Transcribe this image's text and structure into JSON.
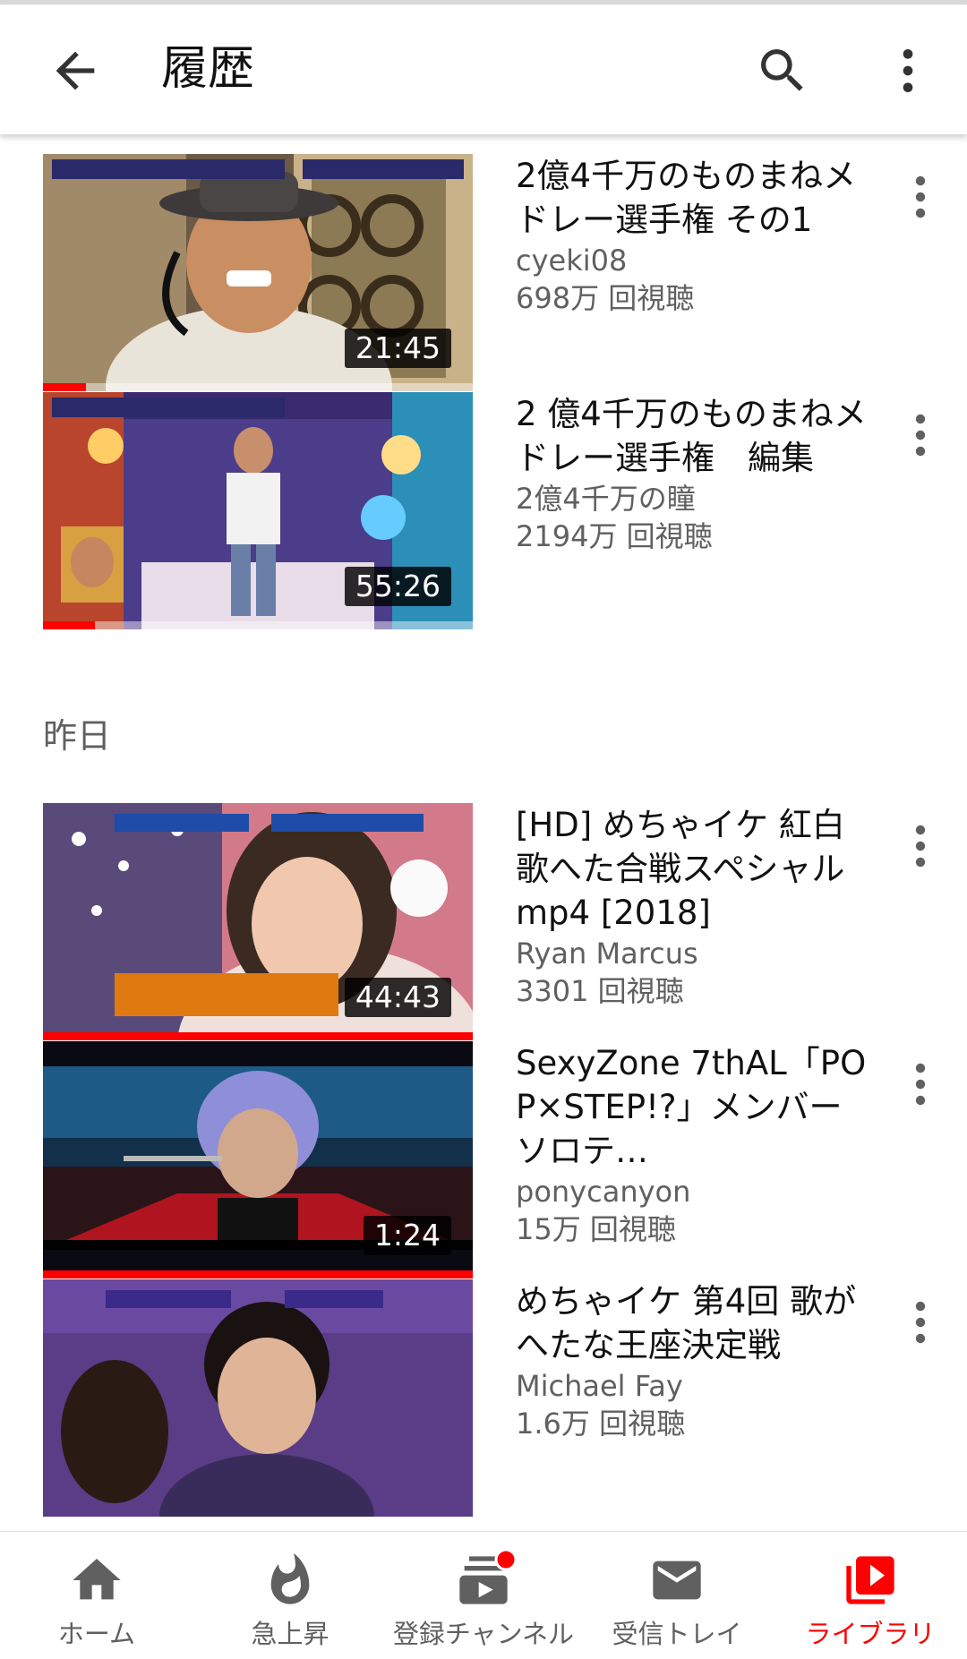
{
  "header": {
    "title": "履歴",
    "back_icon": "arrow-back-icon",
    "search_icon": "search-icon",
    "more_icon": "more-vert-icon"
  },
  "videos": [
    {
      "title": "2億4千万のものまねメドレー選手権 その1",
      "channel": "cyeki08",
      "views": "698万 回視聴",
      "duration": "21:45",
      "watched_fraction": 0.1,
      "thumb_label": "2億4千万のものまねメドレー選手権"
    },
    {
      "title": "2 億4千万のものまねメドレー選手権　編集",
      "channel": "2億4千万の瞳",
      "views": "2194万 回視聴",
      "duration": "55:26",
      "watched_fraction": 0.12,
      "thumb_label": "2億4千万のものまねメドレー選手権"
    }
  ],
  "section_yesterday": "昨日",
  "videos_yesterday": [
    {
      "title": "[HD] めちゃイケ 紅白歌へた合戦スペシャル mp4 [2018]",
      "channel": "Ryan Marcus",
      "views": "3301 回視聴",
      "duration": "44:43",
      "watched_fraction": 1.0,
      "thumb_label": "紅白歌へた合戦スペシャル",
      "thumb_caption": "生で聴く方がス"
    },
    {
      "title": "SexyZone 7thAL「POP×STEP!?」メンバーソロテ…",
      "channel": "ponycanyon",
      "views": "15万 回視聴",
      "duration": "1:24",
      "watched_fraction": 1.0
    },
    {
      "title": "めちゃイケ 第4回 歌がへたな王座決定戦",
      "channel": "Michael Fay",
      "views": "1.6万 回視聴",
      "duration": "",
      "watched_fraction": 0,
      "thumb_label": "歌がへたな王座決定戦"
    }
  ],
  "bottom_nav": [
    {
      "label": "ホーム",
      "icon": "home-icon",
      "active": false
    },
    {
      "label": "急上昇",
      "icon": "flame-icon",
      "active": false
    },
    {
      "label": "登録チャンネル",
      "icon": "subscriptions-icon",
      "active": false,
      "badge": true
    },
    {
      "label": "受信トレイ",
      "icon": "mail-icon",
      "active": false
    },
    {
      "label": "ライブラリ",
      "icon": "library-icon",
      "active": true
    }
  ],
  "colors": {
    "accent": "#ff0000",
    "secondary_text": "#606060",
    "primary_text": "#111111"
  }
}
